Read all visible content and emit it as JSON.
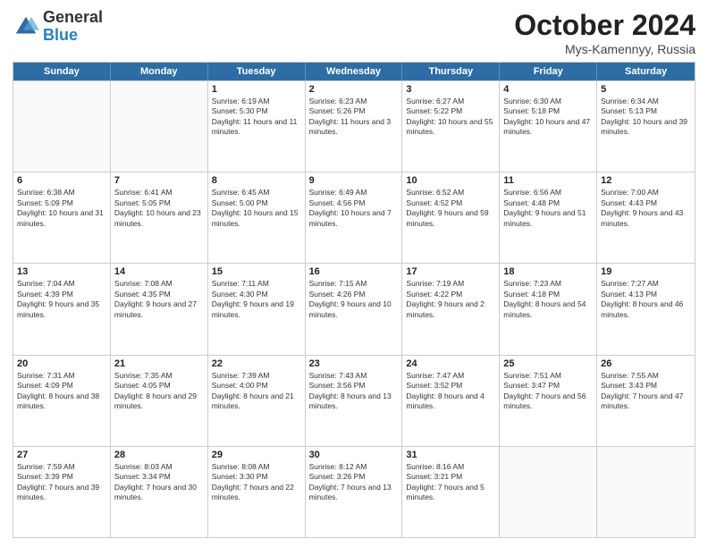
{
  "logo": {
    "general": "General",
    "blue": "Blue"
  },
  "title": {
    "month": "October 2024",
    "location": "Mys-Kamennyy, Russia"
  },
  "weekdays": [
    "Sunday",
    "Monday",
    "Tuesday",
    "Wednesday",
    "Thursday",
    "Friday",
    "Saturday"
  ],
  "rows": [
    [
      {
        "day": "",
        "empty": true
      },
      {
        "day": "",
        "empty": true
      },
      {
        "day": "1",
        "sunrise": "Sunrise: 6:19 AM",
        "sunset": "Sunset: 5:30 PM",
        "daylight": "Daylight: 11 hours and 11 minutes."
      },
      {
        "day": "2",
        "sunrise": "Sunrise: 6:23 AM",
        "sunset": "Sunset: 5:26 PM",
        "daylight": "Daylight: 11 hours and 3 minutes."
      },
      {
        "day": "3",
        "sunrise": "Sunrise: 6:27 AM",
        "sunset": "Sunset: 5:22 PM",
        "daylight": "Daylight: 10 hours and 55 minutes."
      },
      {
        "day": "4",
        "sunrise": "Sunrise: 6:30 AM",
        "sunset": "Sunset: 5:18 PM",
        "daylight": "Daylight: 10 hours and 47 minutes."
      },
      {
        "day": "5",
        "sunrise": "Sunrise: 6:34 AM",
        "sunset": "Sunset: 5:13 PM",
        "daylight": "Daylight: 10 hours and 39 minutes."
      }
    ],
    [
      {
        "day": "6",
        "sunrise": "Sunrise: 6:38 AM",
        "sunset": "Sunset: 5:09 PM",
        "daylight": "Daylight: 10 hours and 31 minutes."
      },
      {
        "day": "7",
        "sunrise": "Sunrise: 6:41 AM",
        "sunset": "Sunset: 5:05 PM",
        "daylight": "Daylight: 10 hours and 23 minutes."
      },
      {
        "day": "8",
        "sunrise": "Sunrise: 6:45 AM",
        "sunset": "Sunset: 5:00 PM",
        "daylight": "Daylight: 10 hours and 15 minutes."
      },
      {
        "day": "9",
        "sunrise": "Sunrise: 6:49 AM",
        "sunset": "Sunset: 4:56 PM",
        "daylight": "Daylight: 10 hours and 7 minutes."
      },
      {
        "day": "10",
        "sunrise": "Sunrise: 6:52 AM",
        "sunset": "Sunset: 4:52 PM",
        "daylight": "Daylight: 9 hours and 59 minutes."
      },
      {
        "day": "11",
        "sunrise": "Sunrise: 6:56 AM",
        "sunset": "Sunset: 4:48 PM",
        "daylight": "Daylight: 9 hours and 51 minutes."
      },
      {
        "day": "12",
        "sunrise": "Sunrise: 7:00 AM",
        "sunset": "Sunset: 4:43 PM",
        "daylight": "Daylight: 9 hours and 43 minutes."
      }
    ],
    [
      {
        "day": "13",
        "sunrise": "Sunrise: 7:04 AM",
        "sunset": "Sunset: 4:39 PM",
        "daylight": "Daylight: 9 hours and 35 minutes."
      },
      {
        "day": "14",
        "sunrise": "Sunrise: 7:08 AM",
        "sunset": "Sunset: 4:35 PM",
        "daylight": "Daylight: 9 hours and 27 minutes."
      },
      {
        "day": "15",
        "sunrise": "Sunrise: 7:11 AM",
        "sunset": "Sunset: 4:30 PM",
        "daylight": "Daylight: 9 hours and 19 minutes."
      },
      {
        "day": "16",
        "sunrise": "Sunrise: 7:15 AM",
        "sunset": "Sunset: 4:26 PM",
        "daylight": "Daylight: 9 hours and 10 minutes."
      },
      {
        "day": "17",
        "sunrise": "Sunrise: 7:19 AM",
        "sunset": "Sunset: 4:22 PM",
        "daylight": "Daylight: 9 hours and 2 minutes."
      },
      {
        "day": "18",
        "sunrise": "Sunrise: 7:23 AM",
        "sunset": "Sunset: 4:18 PM",
        "daylight": "Daylight: 8 hours and 54 minutes."
      },
      {
        "day": "19",
        "sunrise": "Sunrise: 7:27 AM",
        "sunset": "Sunset: 4:13 PM",
        "daylight": "Daylight: 8 hours and 46 minutes."
      }
    ],
    [
      {
        "day": "20",
        "sunrise": "Sunrise: 7:31 AM",
        "sunset": "Sunset: 4:09 PM",
        "daylight": "Daylight: 8 hours and 38 minutes."
      },
      {
        "day": "21",
        "sunrise": "Sunrise: 7:35 AM",
        "sunset": "Sunset: 4:05 PM",
        "daylight": "Daylight: 8 hours and 29 minutes."
      },
      {
        "day": "22",
        "sunrise": "Sunrise: 7:39 AM",
        "sunset": "Sunset: 4:00 PM",
        "daylight": "Daylight: 8 hours and 21 minutes."
      },
      {
        "day": "23",
        "sunrise": "Sunrise: 7:43 AM",
        "sunset": "Sunset: 3:56 PM",
        "daylight": "Daylight: 8 hours and 13 minutes."
      },
      {
        "day": "24",
        "sunrise": "Sunrise: 7:47 AM",
        "sunset": "Sunset: 3:52 PM",
        "daylight": "Daylight: 8 hours and 4 minutes."
      },
      {
        "day": "25",
        "sunrise": "Sunrise: 7:51 AM",
        "sunset": "Sunset: 3:47 PM",
        "daylight": "Daylight: 7 hours and 56 minutes."
      },
      {
        "day": "26",
        "sunrise": "Sunrise: 7:55 AM",
        "sunset": "Sunset: 3:43 PM",
        "daylight": "Daylight: 7 hours and 47 minutes."
      }
    ],
    [
      {
        "day": "27",
        "sunrise": "Sunrise: 7:59 AM",
        "sunset": "Sunset: 3:39 PM",
        "daylight": "Daylight: 7 hours and 39 minutes."
      },
      {
        "day": "28",
        "sunrise": "Sunrise: 8:03 AM",
        "sunset": "Sunset: 3:34 PM",
        "daylight": "Daylight: 7 hours and 30 minutes."
      },
      {
        "day": "29",
        "sunrise": "Sunrise: 8:08 AM",
        "sunset": "Sunset: 3:30 PM",
        "daylight": "Daylight: 7 hours and 22 minutes."
      },
      {
        "day": "30",
        "sunrise": "Sunrise: 8:12 AM",
        "sunset": "Sunset: 3:26 PM",
        "daylight": "Daylight: 7 hours and 13 minutes."
      },
      {
        "day": "31",
        "sunrise": "Sunrise: 8:16 AM",
        "sunset": "Sunset: 3:21 PM",
        "daylight": "Daylight: 7 hours and 5 minutes."
      },
      {
        "day": "",
        "empty": true
      },
      {
        "day": "",
        "empty": true
      }
    ]
  ]
}
